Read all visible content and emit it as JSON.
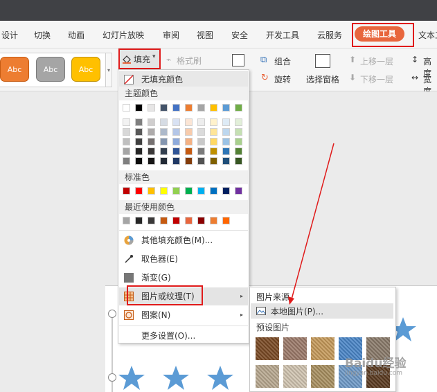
{
  "ribbon_tabs": [
    "设计",
    "切换",
    "动画",
    "幻灯片放映",
    "审阅",
    "视图",
    "安全",
    "开发工具",
    "云服务",
    "绘图工具",
    "文本工"
  ],
  "active_tab": "绘图工具",
  "shape_styles": [
    "Abc",
    "Abc",
    "Abc"
  ],
  "toolbar": {
    "fill_label": "填充",
    "format_brush_label": "格式刷",
    "group_label": "组合",
    "rotate_label": "旋转",
    "select_pane_label": "选择窗格",
    "move_up_label": "上移一层",
    "move_down_label": "下移一层",
    "height_label": "高度",
    "width_label": "宽度"
  },
  "fill_menu": {
    "no_fill": "无填充颜色",
    "theme_colors_header": "主题颜色",
    "standard_colors_header": "标准色",
    "recent_colors_header": "最近使用颜色",
    "other_fill": "其他填充颜色(M)...",
    "eyedropper": "取色器(E)",
    "gradient": "渐变(G)",
    "picture_texture": "图片或纹理(T)",
    "pattern": "图案(N)",
    "more_settings": "更多设置(O)..."
  },
  "submenu": {
    "picture_source_header": "图片来源",
    "local_picture": "本地图片(P)...",
    "preset_header": "预设图片"
  },
  "watermark": "Baidu经验",
  "watermark_url": "jingyan.baidu.com",
  "colors": {
    "accent": "#e8663d",
    "highlight_box": "#e01a1a",
    "theme_top": [
      "#ffffff",
      "#000000",
      "#e7e6e6",
      "#44546a",
      "#4472c4",
      "#ed7d31",
      "#a5a5a5",
      "#ffc000",
      "#5b9bd5",
      "#70ad47"
    ],
    "theme_shades": [
      [
        "#f2f2f2",
        "#7f7f7f",
        "#d0cece",
        "#d6dce4",
        "#d9e2f3",
        "#fbe5d5",
        "#ededed",
        "#fff2cc",
        "#deebf6",
        "#e2efd9"
      ],
      [
        "#d8d8d8",
        "#595959",
        "#aeabab",
        "#adb9ca",
        "#b4c6e7",
        "#f7cbac",
        "#dbdbdb",
        "#fee599",
        "#bdd7ee",
        "#c5e0b3"
      ],
      [
        "#bfbfbf",
        "#3f3f3f",
        "#757070",
        "#8496b0",
        "#8eaadb",
        "#f4b183",
        "#c9c9c9",
        "#ffd965",
        "#9cc3e5",
        "#a8d08d"
      ],
      [
        "#a5a5a5",
        "#262626",
        "#3a3838",
        "#323f4f",
        "#2f5496",
        "#c55a11",
        "#7b7b7b",
        "#bf9000",
        "#2e75b5",
        "#538135"
      ],
      [
        "#7f7f7f",
        "#0c0c0c",
        "#171616",
        "#222a35",
        "#1f3864",
        "#833c0b",
        "#525252",
        "#7f6000",
        "#1e4e79",
        "#375623"
      ]
    ],
    "standard": [
      "#c00000",
      "#ff0000",
      "#ffc000",
      "#ffff00",
      "#92d050",
      "#00b050",
      "#00b0f0",
      "#0070c0",
      "#002060",
      "#7030a0"
    ],
    "recent": [
      "#a5a5a5",
      "#262626",
      "#3a3838",
      "#c55a11",
      "#c00000",
      "#e8663d",
      "#8b0000",
      "#ed7d31",
      "#ff6600"
    ],
    "shape_style_fills": [
      "#ed7d31",
      "#a5a5a5",
      "#ffc000"
    ],
    "textures": [
      "#7a4a24",
      "#9c7a6a",
      "#c69a5a",
      "#4a86c8",
      "#8a7a6a",
      "#b8a890",
      "#d0c4b0",
      "#a89060",
      "#6e9ac8",
      "#5a3a20"
    ]
  },
  "icons": {
    "fill": "paint-bucket-icon",
    "no_fill": "slash-icon",
    "other_fill": "color-wheel-icon",
    "eyedropper": "eyedropper-icon",
    "gradient": "gradient-icon",
    "texture": "texture-icon",
    "pattern": "pattern-icon",
    "picture": "picture-icon",
    "arrow": "submenu-arrow-icon"
  }
}
